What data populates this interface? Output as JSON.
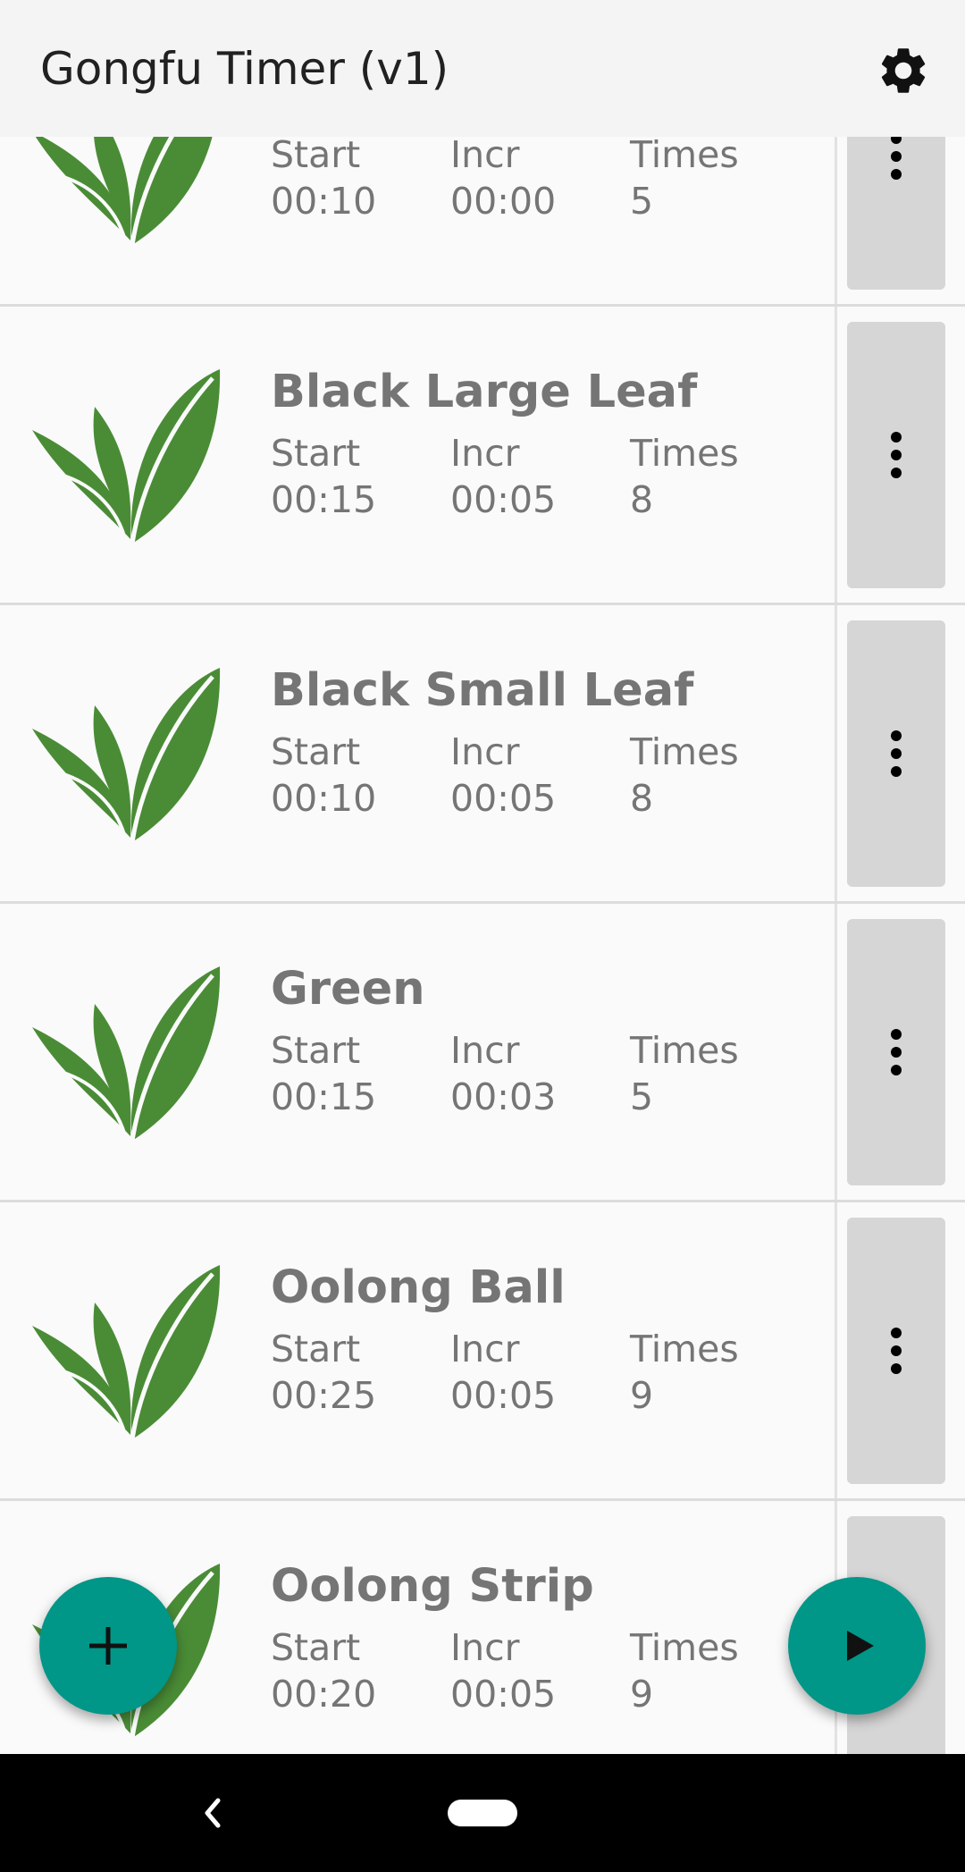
{
  "app": {
    "title": "Gongfu Timer (v1)"
  },
  "icons": {
    "settings": "gear-icon",
    "leaf": "tea-leaf-icon",
    "menu": "more-vert-icon",
    "add": "plus-icon",
    "play": "play-icon",
    "back": "back-icon",
    "home": "home-pill"
  },
  "colors": {
    "accent": "#009688",
    "leaf": "#4a8c36",
    "text": "#757575",
    "menu_bg": "#d6d6d6"
  },
  "labels": {
    "start": "Start",
    "incr": "Incr",
    "times": "Times"
  },
  "teas": [
    {
      "name": "",
      "start": "00:10",
      "incr": "00:00",
      "times": "5"
    },
    {
      "name": "Black Large Leaf",
      "start": "00:15",
      "incr": "00:05",
      "times": "8"
    },
    {
      "name": "Black Small Leaf",
      "start": "00:10",
      "incr": "00:05",
      "times": "8"
    },
    {
      "name": "Green",
      "start": "00:15",
      "incr": "00:03",
      "times": "5"
    },
    {
      "name": "Oolong Ball",
      "start": "00:25",
      "incr": "00:05",
      "times": "9"
    },
    {
      "name": "Oolong Strip",
      "start": "00:20",
      "incr": "00:05",
      "times": "9"
    }
  ]
}
